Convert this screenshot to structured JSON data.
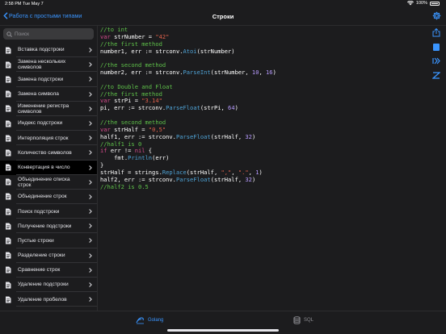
{
  "status_bar": {
    "time": "2:58 PM",
    "date": "Tue May 7",
    "battery_text": "100%"
  },
  "header": {
    "back_label": "Работа с простыми типами",
    "title": "Строки"
  },
  "search": {
    "placeholder": "Поиск"
  },
  "sidebar": {
    "items": [
      {
        "label": "Вставка подстроки"
      },
      {
        "label": "Замена нескольких символов"
      },
      {
        "label": "Замена подстроки"
      },
      {
        "label": "Замена символа"
      },
      {
        "label": "Изменение регистра символов"
      },
      {
        "label": "Индекс подстроки"
      },
      {
        "label": "Интерполяция строк"
      },
      {
        "label": "Количество символов"
      },
      {
        "label": "Конвертация в число"
      },
      {
        "label": "Объединение списка строк"
      },
      {
        "label": "Объединение строк"
      },
      {
        "label": "Поиск подстроки"
      },
      {
        "label": "Получение подстроки"
      },
      {
        "label": "Пустые строки"
      },
      {
        "label": "Разделение строки"
      },
      {
        "label": "Сравнение строк"
      },
      {
        "label": "Удаление подстроки"
      },
      {
        "label": "Удаление пробелов"
      }
    ],
    "active_index": 8
  },
  "code": {
    "lines": [
      [
        [
          "cm",
          "//to int"
        ]
      ],
      [
        [
          "kw",
          "var"
        ],
        [
          "t",
          " strNumber = "
        ],
        [
          "str",
          "\"42\""
        ]
      ],
      [
        [
          "cm",
          "//the first method"
        ]
      ],
      [
        [
          "t",
          "number1, err := strconv."
        ],
        [
          "fn",
          "Atoi"
        ],
        [
          "t",
          "(strNumber)"
        ]
      ],
      [],
      [
        [
          "cm",
          "//the second method"
        ]
      ],
      [
        [
          "t",
          "number2, err := strconv."
        ],
        [
          "fn",
          "ParseInt"
        ],
        [
          "t",
          "(strNumber, "
        ],
        [
          "num",
          "10"
        ],
        [
          "t",
          ", "
        ],
        [
          "num",
          "16"
        ],
        [
          "t",
          ")"
        ]
      ],
      [],
      [
        [
          "cm",
          "//to Double and Float"
        ]
      ],
      [
        [
          "cm",
          "//the first method"
        ]
      ],
      [
        [
          "kw",
          "var"
        ],
        [
          "t",
          " strPi = "
        ],
        [
          "str",
          "\"3.14\""
        ]
      ],
      [
        [
          "t",
          "pi, err := strconv."
        ],
        [
          "fn",
          "ParseFloat"
        ],
        [
          "t",
          "(strPi, "
        ],
        [
          "num",
          "64"
        ],
        [
          "t",
          ")"
        ]
      ],
      [],
      [
        [
          "cm",
          "//the second method"
        ]
      ],
      [
        [
          "kw",
          "var"
        ],
        [
          "t",
          " strHalf = "
        ],
        [
          "str",
          "\"0,5\""
        ]
      ],
      [
        [
          "t",
          "half1, err := strconv."
        ],
        [
          "fn",
          "ParseFloat"
        ],
        [
          "t",
          "(strHalf, "
        ],
        [
          "num",
          "32"
        ],
        [
          "t",
          ")"
        ]
      ],
      [
        [
          "cm",
          "//half1 is 0"
        ]
      ],
      [
        [
          "kw",
          "if"
        ],
        [
          "t",
          " err != "
        ],
        [
          "kw",
          "nil"
        ],
        [
          "t",
          " {"
        ]
      ],
      [
        [
          "t",
          "    fmt."
        ],
        [
          "fn",
          "Println"
        ],
        [
          "t",
          "(err)"
        ]
      ],
      [
        [
          "t",
          "}"
        ]
      ],
      [
        [
          "t",
          "strHalf = strings."
        ],
        [
          "fn",
          "Replace"
        ],
        [
          "t",
          "(strHalf, "
        ],
        [
          "str",
          "\",\""
        ],
        [
          "t",
          ", "
        ],
        [
          "str",
          "\".\""
        ],
        [
          "t",
          ", "
        ],
        [
          "num",
          "1"
        ],
        [
          "t",
          ")"
        ]
      ],
      [
        [
          "t",
          "half2, err := strconv."
        ],
        [
          "fn",
          "ParseFloat"
        ],
        [
          "t",
          "(strHalf, "
        ],
        [
          "num",
          "32"
        ],
        [
          "t",
          ")"
        ]
      ],
      [
        [
          "cm",
          "//half2 is 0.5"
        ]
      ]
    ]
  },
  "tabs": [
    {
      "label": "Golang",
      "icon": "golang-icon",
      "selected": true
    },
    {
      "label": "SQL",
      "icon": "database-icon",
      "selected": false
    }
  ],
  "colors": {
    "accent": "#3a95ff",
    "comment": "#5fc24a",
    "keyword": "#d44b8c",
    "string": "#e0614c",
    "function": "#4fa3d6",
    "number": "#b79bff"
  }
}
